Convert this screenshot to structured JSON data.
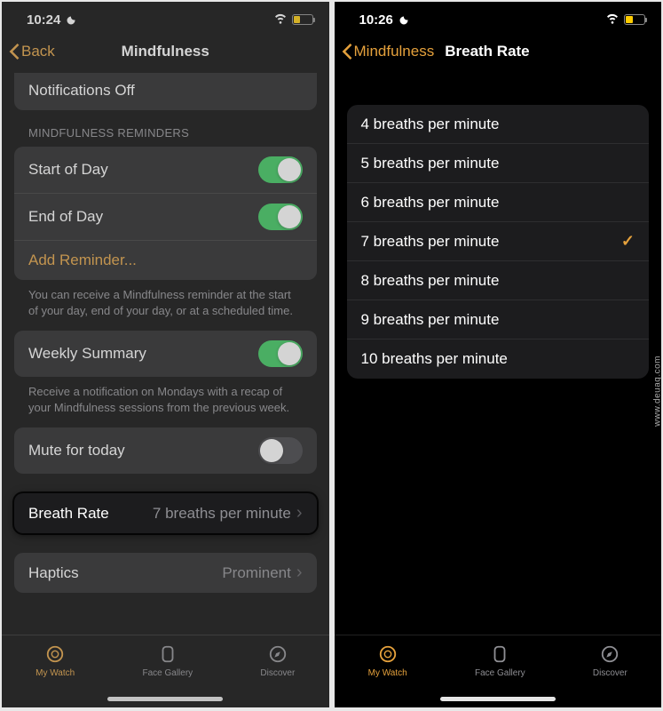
{
  "left": {
    "status": {
      "time": "10:24"
    },
    "nav": {
      "back": "Back",
      "title": "Mindfulness"
    },
    "notifications_off": "Notifications Off",
    "reminders": {
      "header": "MINDFULNESS REMINDERS",
      "start_of_day": "Start of Day",
      "end_of_day": "End of Day",
      "add_reminder": "Add Reminder...",
      "footer": "You can receive a Mindfulness reminder at the start of your day, end of your day, or at a scheduled time."
    },
    "weekly": {
      "label": "Weekly Summary",
      "footer": "Receive a notification on Mondays with a recap of your Mindfulness sessions from the previous week."
    },
    "mute": {
      "label": "Mute for today"
    },
    "breath_rate": {
      "label": "Breath Rate",
      "value": "7 breaths per minute"
    },
    "haptics": {
      "label": "Haptics",
      "value": "Prominent"
    },
    "tabs": {
      "my_watch": "My Watch",
      "face_gallery": "Face Gallery",
      "discover": "Discover"
    }
  },
  "right": {
    "status": {
      "time": "10:26"
    },
    "nav": {
      "back": "Mindfulness",
      "title": "Breath Rate"
    },
    "options": [
      "4 breaths per minute",
      "5 breaths per minute",
      "6 breaths per minute",
      "7 breaths per minute",
      "8 breaths per minute",
      "9 breaths per minute",
      "10 breaths per minute"
    ],
    "selected_index": 3,
    "tabs": {
      "my_watch": "My Watch",
      "face_gallery": "Face Gallery",
      "discover": "Discover"
    }
  },
  "watermark": "www.deuaq.com"
}
